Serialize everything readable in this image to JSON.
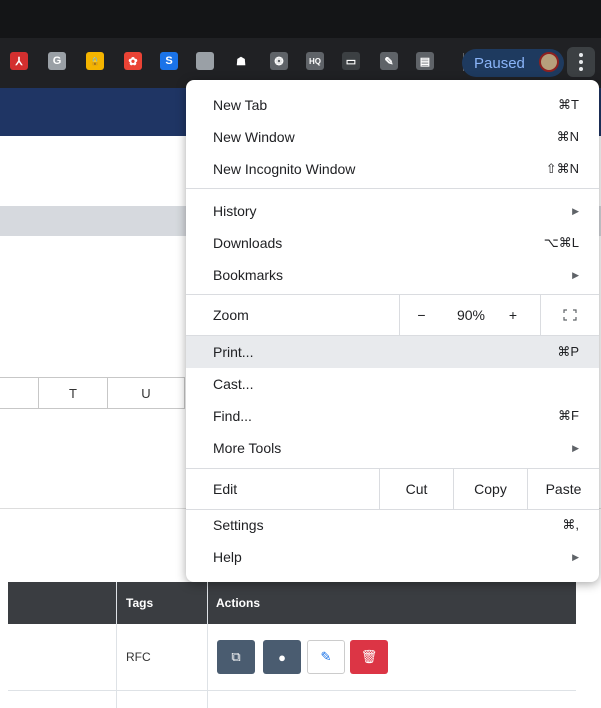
{
  "toolbar": {
    "extensions": [
      {
        "icon": "acrobat-icon",
        "glyph": "⅄",
        "color": "#d32f2f"
      },
      {
        "icon": "grammarly-g-icon",
        "glyph": "G",
        "color": "#9aa0a6"
      },
      {
        "icon": "padlock-extension-icon",
        "glyph": "🔒",
        "color": "#f4b400"
      },
      {
        "icon": "color-wheel-icon",
        "glyph": "✿",
        "color": "#ea4335"
      },
      {
        "icon": "s-extension-icon",
        "glyph": "S",
        "color": "#1a73e8"
      },
      {
        "icon": "ring-extension-icon",
        "glyph": "ring",
        "color": "#9aa0a6"
      },
      {
        "icon": "mask-extension-icon",
        "glyph": "☗",
        "color": "#202124"
      },
      {
        "icon": "openai-icon",
        "glyph": "❂",
        "color": "#5f6368"
      },
      {
        "icon": "cloudhq-icon",
        "glyph": "HQ",
        "color": "#5f6368"
      },
      {
        "icon": "camera-extension-icon",
        "glyph": "▭",
        "color": "#3c4043"
      },
      {
        "icon": "signature-extension-icon",
        "glyph": "✎",
        "color": "#5f6368"
      },
      {
        "icon": "document-extension-icon",
        "glyph": "▤",
        "color": "#5f6368"
      }
    ],
    "paused_label": "Paused"
  },
  "background_page": {
    "spreadsheet_columns": [
      "T",
      "U"
    ],
    "table_headers": [
      "Tags",
      "Actions"
    ],
    "rows": [
      {
        "tags": "RFC"
      }
    ]
  },
  "menu": {
    "new_tab": {
      "label": "New Tab",
      "shortcut": "⌘T"
    },
    "new_window": {
      "label": "New Window",
      "shortcut": "⌘N"
    },
    "new_incognito": {
      "label": "New Incognito Window",
      "shortcut": "⇧⌘N"
    },
    "history": {
      "label": "History"
    },
    "downloads": {
      "label": "Downloads",
      "shortcut": "⌥⌘L"
    },
    "bookmarks": {
      "label": "Bookmarks"
    },
    "zoom": {
      "label": "Zoom",
      "minus": "−",
      "value": "90%",
      "plus": "+"
    },
    "print": {
      "label": "Print...",
      "shortcut": "⌘P"
    },
    "cast": {
      "label": "Cast..."
    },
    "find": {
      "label": "Find...",
      "shortcut": "⌘F"
    },
    "more_tools": {
      "label": "More Tools"
    },
    "edit": {
      "label": "Edit",
      "cut": "Cut",
      "copy": "Copy",
      "paste": "Paste"
    },
    "settings": {
      "label": "Settings",
      "shortcut": "⌘,"
    },
    "help": {
      "label": "Help"
    },
    "submenu_arrow": "▶"
  }
}
